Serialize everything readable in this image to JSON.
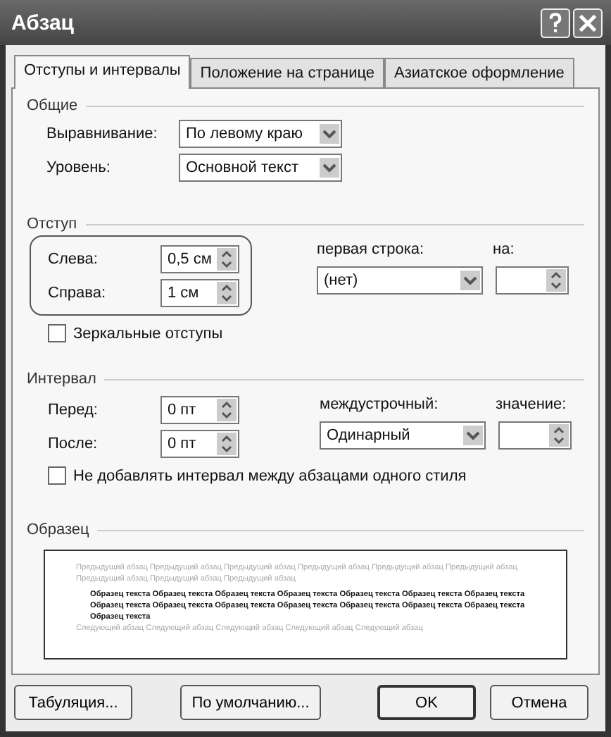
{
  "window": {
    "title": "Абзац"
  },
  "tabs": [
    {
      "label": "Отступы и интервалы",
      "selected": true
    },
    {
      "label": "Положение на странице",
      "selected": false
    },
    {
      "label": "Азиатское оформление",
      "selected": false
    }
  ],
  "general": {
    "title": "Общие",
    "fields": [
      {
        "label": "Выравнивание:",
        "value": "По левому краю"
      },
      {
        "label": "Уровень:",
        "value": "Основной текст"
      }
    ]
  },
  "indent": {
    "title": "Отступ",
    "left": {
      "label": "Слева:",
      "value": "0,5 см"
    },
    "right": {
      "label": "Справа:",
      "value": "1 см"
    },
    "first_line": {
      "label": "первая строка:",
      "value": "(нет)"
    },
    "by": {
      "label": "на:"
    },
    "mirror": {
      "label": "Зеркальные отступы",
      "checked": false
    }
  },
  "spacing": {
    "title": "Интервал",
    "before": {
      "label": "Перед:",
      "value": "0 пт"
    },
    "after": {
      "label": "После:",
      "value": "0 пт"
    },
    "line": {
      "label": "междустрочный:",
      "value": "Одинарный"
    },
    "at": {
      "label": "значение:"
    },
    "no_space": {
      "label": "Не добавлять интервал между абзацами одного стиля",
      "checked": false
    }
  },
  "preview": {
    "title": "Образец",
    "previous": "Предыдущий абзац Предыдущий абзац Предыдущий абзац Предыдущий абзац Предыдущий абзац Предыдущий абзац Предыдущий абзац Предыдущий абзац Предыдущий абзац",
    "sample": "Образец текста Образец текста Образец текста Образец текста Образец текста Образец текста Образец текста Образец текста Образец текста Образец текста Образец текста Образец текста Образец текста Образец текста Образец текста",
    "next": "Следующий абзац Следующий абзац Следующий абзац Следующий абзац Следующий абзац"
  },
  "buttons": [
    {
      "label": "Табуляция...",
      "default": false
    },
    {
      "label": "По умолчанию...",
      "default": false
    },
    {
      "label": "OK",
      "default": true
    },
    {
      "label": "Отмена",
      "default": false
    }
  ]
}
